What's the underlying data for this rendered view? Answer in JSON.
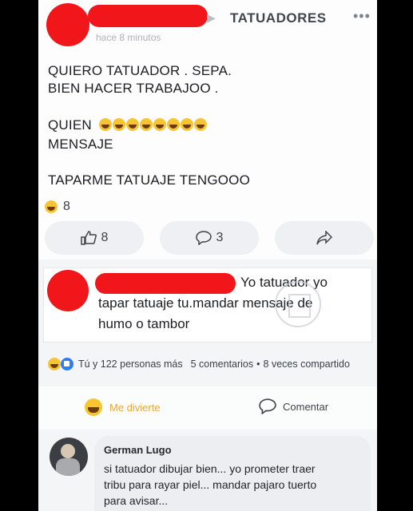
{
  "post": {
    "group_name": "TATUADORES",
    "time": "hace 8 minutos",
    "more_icon": "more-dots-icon",
    "lines": [
      "QUIERO TATUADOR . SEPA.",
      "BIEN HACER TRABAJOO .",
      "QUIEN",
      "MENSAJE",
      "TAPARME TATUAJE TENGOOO"
    ],
    "reaction_count": "8",
    "buttons": {
      "like_count": "8",
      "comment_count": "3",
      "like_icon": "thumbs-up-icon",
      "comment_icon": "comment-icon",
      "share_icon": "share-icon"
    }
  },
  "top_comment": {
    "line1": "Yo tatuador yo",
    "line2": "tapar tatuaje tu.mandar mensaje de",
    "line3": "humo o tambor"
  },
  "stats": {
    "reactions": "Tú y 122 personas más",
    "comments": "5 comentarios",
    "separator": "•",
    "shares": "8 veces compartido"
  },
  "actions": {
    "react_label": "Me divierte",
    "comment_label": "Comentar"
  },
  "comment": {
    "author": "German Lugo",
    "text": "si tatuador dibujar bien... yo prometer traer\ntribu para rayar piel... mandar pajaro tuerto\npara avisar..."
  },
  "colors": {
    "redaction": "#f0161a",
    "like_blue": "#2d7df6",
    "haha_yellow": "#f6c531"
  }
}
